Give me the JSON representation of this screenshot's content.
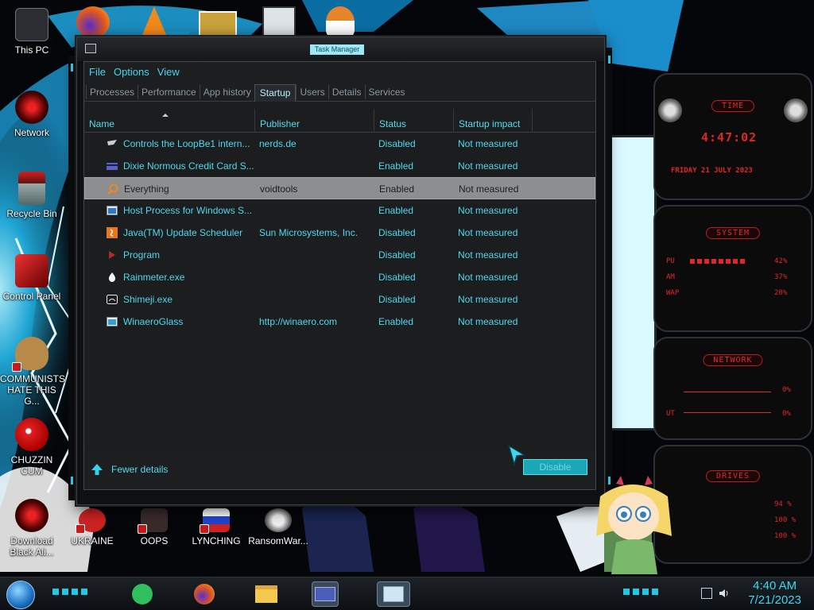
{
  "window": {
    "title": "Task Manager",
    "menu": [
      "File",
      "Options",
      "View"
    ],
    "tabs": [
      "Processes",
      "Performance",
      "App history",
      "Startup",
      "Users",
      "Details",
      "Services"
    ],
    "active_tab": "Startup",
    "columns": [
      "Name",
      "Publisher",
      "Status",
      "Startup impact"
    ],
    "rows": [
      {
        "name": "Controls the LoopBe1 intern...",
        "publisher": "nerds.de",
        "status": "Disabled",
        "impact": "Not measured",
        "icon": "app-icon"
      },
      {
        "name": "Dixie Normous Credit Card S...",
        "publisher": "",
        "status": "Enabled",
        "impact": "Not measured",
        "icon": "card-icon"
      },
      {
        "name": "Everything",
        "publisher": "voidtools",
        "status": "Enabled",
        "impact": "Not measured",
        "icon": "search-icon",
        "selected": true
      },
      {
        "name": "Host Process for Windows S...",
        "publisher": "",
        "status": "Enabled",
        "impact": "Not measured",
        "icon": "window-icon"
      },
      {
        "name": "Java(TM) Update Scheduler",
        "publisher": "Sun Microsystems, Inc.",
        "status": "Disabled",
        "impact": "Not measured",
        "icon": "java-icon"
      },
      {
        "name": "Program",
        "publisher": "",
        "status": "Disabled",
        "impact": "Not measured",
        "icon": "program-icon"
      },
      {
        "name": "Rainmeter.exe",
        "publisher": "",
        "status": "Disabled",
        "impact": "Not measured",
        "icon": "droplet-icon"
      },
      {
        "name": "Shimeji.exe",
        "publisher": "",
        "status": "Disabled",
        "impact": "Not measured",
        "icon": "shimeji-icon"
      },
      {
        "name": "WinaeroGlass",
        "publisher": "http://winaero.com",
        "status": "Enabled",
        "impact": "Not measured",
        "icon": "glass-icon"
      }
    ],
    "fewer_details": "Fewer details",
    "disable_button": "Disable"
  },
  "desktop_icons": [
    {
      "label": "This PC",
      "icon": "computer-icon"
    },
    {
      "label": "Network",
      "icon": "network-icon"
    },
    {
      "label": "Recycle Bin",
      "icon": "recycle-bin-icon"
    },
    {
      "label": "Control Panel",
      "icon": "control-panel-icon"
    },
    {
      "label": "COMMUNISTS HATE THIS G...",
      "icon": "money-bag-icon"
    },
    {
      "label": "CHUZZIN CUM",
      "icon": "chuzzle-icon"
    },
    {
      "label": "Download Black Ali...",
      "icon": "alienware-icon"
    },
    {
      "label": "UKRAINE",
      "icon": "ukraine-icon"
    },
    {
      "label": "OOPS",
      "icon": "oops-icon"
    },
    {
      "label": "LYNCHING",
      "icon": "lynching-icon"
    },
    {
      "label": "RansomWar...",
      "icon": "skull-icon"
    }
  ],
  "gadgets": {
    "time": {
      "title": "TIME",
      "clock": "4:47:02",
      "date": "FRIDAY 21 JULY 2023"
    },
    "system": {
      "title": "SYSTEM",
      "rows": [
        {
          "label": "PU",
          "value": "42%"
        },
        {
          "label": "AM",
          "value": "37%"
        },
        {
          "label": "WAP",
          "value": "20%"
        }
      ]
    },
    "network": {
      "title": "NETWORK",
      "rows": [
        {
          "label": "",
          "value": "0%"
        },
        {
          "label": "UT",
          "value": "0%"
        }
      ]
    },
    "drives": {
      "title": "DRIVES",
      "rows": [
        {
          "label": "",
          "value": "94 %"
        },
        {
          "label": "",
          "value": "100 %"
        },
        {
          "label": "",
          "value": "100 %"
        }
      ]
    }
  },
  "taskbar": {
    "time": "4:40 AM",
    "date": "7/21/2023"
  },
  "colors": {
    "accent": "#41d9f0",
    "gadget_red": "#e02626",
    "window_bg": "#1d1e20"
  }
}
